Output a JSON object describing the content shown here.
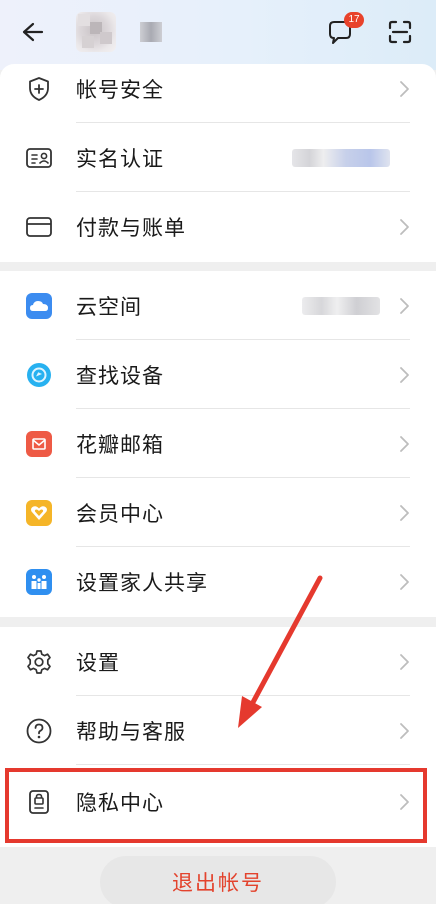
{
  "header": {
    "back_icon": "back-arrow-icon",
    "message_badge": "17",
    "message_icon": "chat-bubble-icon",
    "scan_icon": "scan-icon"
  },
  "section1": {
    "items": [
      {
        "label": "帐号安全",
        "icon": "shield-plus-icon"
      },
      {
        "label": "实名认证",
        "icon": "id-card-icon"
      },
      {
        "label": "付款与账单",
        "icon": "card-icon"
      }
    ]
  },
  "section2": {
    "items": [
      {
        "label": "云空间",
        "icon": "cloud-icon"
      },
      {
        "label": "查找设备",
        "icon": "find-device-icon"
      },
      {
        "label": "花瓣邮箱",
        "icon": "mail-icon"
      },
      {
        "label": "会员中心",
        "icon": "vip-heart-icon"
      },
      {
        "label": "设置家人共享",
        "icon": "family-icon"
      }
    ]
  },
  "section3": {
    "items": [
      {
        "label": "设置",
        "icon": "gear-icon"
      },
      {
        "label": "帮助与客服",
        "icon": "help-icon"
      },
      {
        "label": "隐私中心",
        "icon": "privacy-icon"
      }
    ]
  },
  "logout_label": "退出帐号",
  "colors": {
    "accent_red": "#e3432d",
    "highlight_red": "#e5392e",
    "badge_red": "#e8422b"
  }
}
